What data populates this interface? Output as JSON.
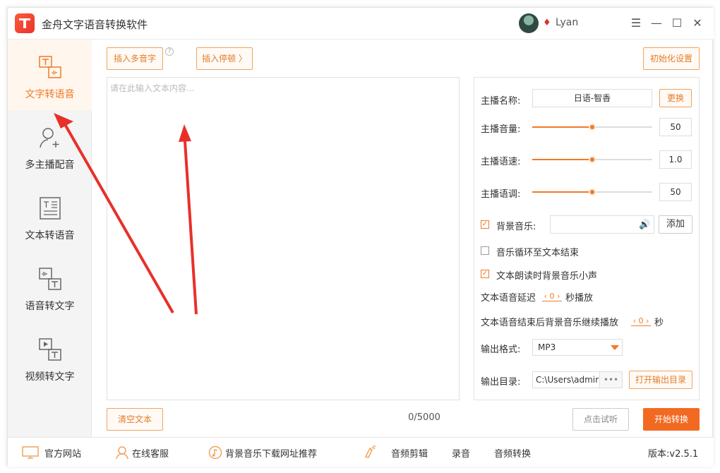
{
  "app": {
    "title": "金舟文字语音转换软件",
    "username": "Lyan"
  },
  "window_controls": {
    "menu": "☰",
    "minimize": "—",
    "maximize": "☐",
    "close": "✕"
  },
  "sidebar": {
    "items": [
      {
        "label": "文字转语音",
        "active": true
      },
      {
        "label": "多主播配音",
        "active": false
      },
      {
        "label": "文本转语音",
        "active": false
      },
      {
        "label": "语音转文字",
        "active": false
      },
      {
        "label": "视频转文字",
        "active": false
      }
    ]
  },
  "toolbar": {
    "insert_polyphone": "插入多音字",
    "help": "?",
    "insert_pause": "插入停顿 〉",
    "reset_settings": "初始化设置"
  },
  "editor": {
    "placeholder": "请在此输入文本内容...",
    "counter": "0/5000",
    "clear_label": "清空文本"
  },
  "settings": {
    "anchor_name_label": "主播名称:",
    "anchor_name_value": "日语-智香",
    "change_label": "更换",
    "volume_label": "主播音量:",
    "volume_value": "50",
    "volume_fraction": 0.5,
    "speed_label": "主播语速:",
    "speed_value": "1.0",
    "speed_fraction": 0.5,
    "pitch_label": "主播语调:",
    "pitch_value": "50",
    "pitch_fraction": 0.5,
    "bg_music_label": "背景音乐:",
    "bg_music_checked": true,
    "add_label": "添加",
    "loop_label": "音乐循环至文本结束",
    "loop_checked": false,
    "duck_label": "文本朗读时背景音乐小声",
    "duck_checked": true,
    "delay_prefix": "文本语音延迟",
    "delay_value": "0",
    "delay_suffix": "秒播放",
    "continue_prefix": "文本语音结束后背景音乐继续播放",
    "continue_value": "0",
    "continue_suffix": "秒",
    "format_label": "输出格式:",
    "format_value": "MP3",
    "dir_label": "输出目录:",
    "dir_value": "C:\\Users\\admir",
    "dir_browse": "•••",
    "open_dir_label": "打开输出目录"
  },
  "actions": {
    "listen_label": "点击试听",
    "start_label": "开始转换"
  },
  "footer": {
    "website": "官方网站",
    "support": "在线客服",
    "music_sites": "背景音乐下载网址推荐",
    "audio_edit": "音频剪辑",
    "record": "录音",
    "audio_convert": "音频转换",
    "version": "版本:v2.5.1"
  },
  "colors": {
    "accent": "#f07a27",
    "primary_button": "#f26a22",
    "annotation_arrow": "#e8302a"
  }
}
